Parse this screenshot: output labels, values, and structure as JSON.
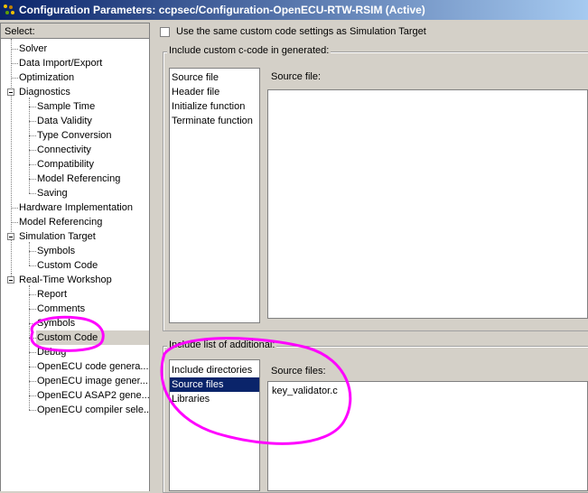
{
  "window": {
    "title": "Configuration Parameters: ccpsec/Configuration-OpenECU-RTW-RSIM (Active)"
  },
  "select_label": "Select:",
  "tree": {
    "solver": "Solver",
    "data_import_export": "Data Import/Export",
    "optimization": "Optimization",
    "diagnostics": "Diagnostics",
    "sample_time": "Sample Time",
    "data_validity": "Data Validity",
    "type_conversion": "Type Conversion",
    "connectivity": "Connectivity",
    "compatibility": "Compatibility",
    "model_referencing_diag": "Model Referencing",
    "saving": "Saving",
    "hardware_implementation": "Hardware Implementation",
    "model_referencing": "Model Referencing",
    "simulation_target": "Simulation Target",
    "sim_symbols": "Symbols",
    "sim_custom_code": "Custom Code",
    "rtw": "Real-Time Workshop",
    "report": "Report",
    "comments": "Comments",
    "rtw_symbols": "Symbols",
    "rtw_custom_code": "Custom Code",
    "debug": "Debug",
    "openecu_codegen": "OpenECU code genera...",
    "openecu_imagegen": "OpenECU image gener...",
    "openecu_asap2": "OpenECU ASAP2 gene...",
    "openecu_compiler": "OpenECU compiler sele..."
  },
  "checkbox": {
    "label": "Use the same custom code settings as Simulation Target",
    "checked": false
  },
  "custom_code_group": {
    "legend": "Include custom c-code in generated:",
    "items": [
      "Source file",
      "Header file",
      "Initialize function",
      "Terminate function"
    ],
    "field_label": "Source file:",
    "value": ""
  },
  "include_list_group": {
    "legend": "Include list of additional:",
    "items": [
      "Include directories",
      "Source files",
      "Libraries"
    ],
    "field_label": "Source files:",
    "value": "key_validator.c"
  },
  "colors": {
    "annotation": "#ff00ff",
    "selection": "#0a246a",
    "title_start": "#0a246a",
    "title_end": "#a6caf0"
  }
}
